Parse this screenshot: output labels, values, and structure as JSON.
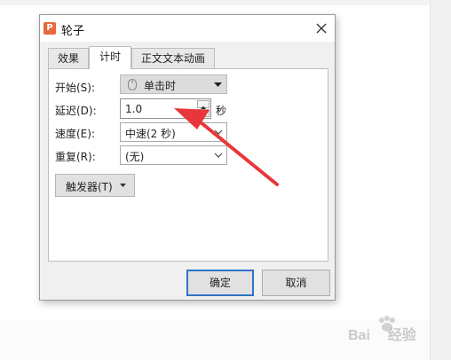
{
  "window": {
    "title": "轮子",
    "app_logo_letter": "P"
  },
  "tabs": [
    {
      "label": "效果",
      "active": false
    },
    {
      "label": "计时",
      "active": true
    },
    {
      "label": "正文文本动画",
      "active": false
    }
  ],
  "form": {
    "start": {
      "label": "开始(S):",
      "value": "单击时",
      "icon": "mouse-icon"
    },
    "delay": {
      "label": "延迟(D):",
      "value": "1.0",
      "unit": "秒"
    },
    "speed": {
      "label": "速度(E):",
      "value": "中速(2 秒)"
    },
    "repeat": {
      "label": "重复(R):",
      "value": "(无)"
    },
    "trigger": {
      "label": "触发器(T)"
    }
  },
  "buttons": {
    "ok": "确定",
    "cancel": "取消"
  },
  "watermark": {
    "text": "Bai",
    "subtext": "经验"
  },
  "colors": {
    "annotation_arrow": "#e8373a",
    "focus_border": "#2f73c9",
    "logo": "#e7683a"
  }
}
